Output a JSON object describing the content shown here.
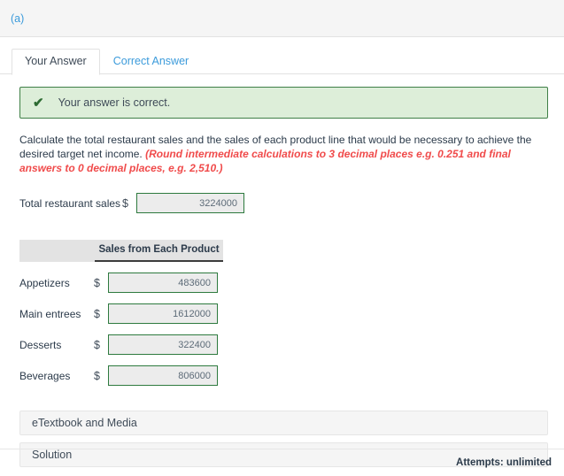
{
  "part": {
    "label": "(a)"
  },
  "tabs": [
    {
      "label": "Your Answer",
      "active": true
    },
    {
      "label": "Correct Answer",
      "active": false
    }
  ],
  "alert": {
    "icon": "check-icon",
    "message": "Your answer is correct.",
    "background_color": "#ddeed9",
    "border_color": "#3f7f46",
    "icon_color": "#2d6b33"
  },
  "instructions": {
    "main": "Calculate the total restaurant sales and the sales of each product line that would be necessary to achieve the desired target net income. ",
    "emphasis": "(Round intermediate calculations to 3 decimal places e.g. 0.251 and final answers to 0 decimal places, e.g. 2,510.)",
    "emphasis_color": "#f04b4b"
  },
  "total_row": {
    "label": "Total restaurant sales",
    "currency": "$",
    "value": "3224000",
    "placeholder": ""
  },
  "product_table": {
    "column_header_blank": "",
    "column_header": "Sales from Each Product",
    "currency": "$",
    "rows": [
      {
        "label": "Appetizers",
        "value": "483600"
      },
      {
        "label": "Main entrees",
        "value": "1612000"
      },
      {
        "label": "Desserts",
        "value": "322400"
      },
      {
        "label": "Beverages",
        "value": "806000"
      }
    ]
  },
  "accordions": [
    {
      "label": "eTextbook and Media"
    },
    {
      "label": "Solution"
    }
  ],
  "footer": {
    "attempts": "Attempts: unlimited"
  },
  "colors": {
    "field_border": "#2d7a3e",
    "field_background": "#ececec",
    "link": "#3c9bdb",
    "header_bar": "#f5f5f5"
  }
}
